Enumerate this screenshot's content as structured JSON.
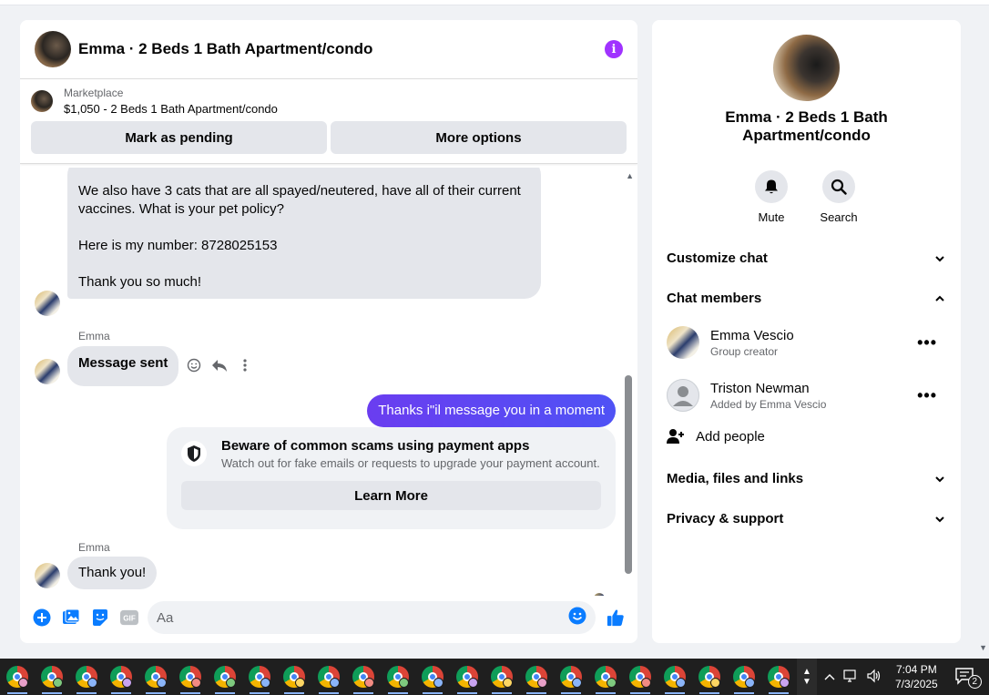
{
  "chat": {
    "title": "Emma · 2 Beds 1 Bath Apartment/condo",
    "listing": {
      "label": "Marketplace",
      "price_title": "$1,050 - 2 Beds 1 Bath Apartment/condo",
      "mark_pending": "Mark as pending",
      "more_options": "More options"
    },
    "messages": {
      "long_message": "We also have 3 cats that are all spayed/neutered, have all of their current vaccines. What is your pet policy?\n\nHere is my number: 8728025153\n\nThank you so much!",
      "sender_1": "Emma",
      "message_sent": "Message sent",
      "outgoing": "Thanks i\"il message you in a moment",
      "scam_title": "Beware of common scams using payment apps",
      "scam_sub": "Watch out for fake emails or requests to upgrade your payment account.",
      "learn_more": "Learn More",
      "sender_2": "Emma",
      "thank_you": "Thank you!"
    },
    "composer": {
      "placeholder": "Aa"
    }
  },
  "side": {
    "title": "Emma · 2 Beds 1 Bath Apartment/condo",
    "mute": "Mute",
    "search": "Search",
    "customize_chat": "Customize chat",
    "chat_members": "Chat members",
    "members": [
      {
        "name": "Emma Vescio",
        "sub": "Group creator"
      },
      {
        "name": "Triston Newman",
        "sub": "Added by Emma Vescio"
      }
    ],
    "add_people": "Add people",
    "media": "Media, files and links",
    "privacy": "Privacy & support"
  },
  "taskbar": {
    "time": "7:04 PM",
    "date": "7/3/2025",
    "notification_count": "2"
  },
  "colors": {
    "accent": "#0a7cff",
    "outgoing_bubble": "#5b3cf6",
    "info_icon": "#a033ff"
  }
}
